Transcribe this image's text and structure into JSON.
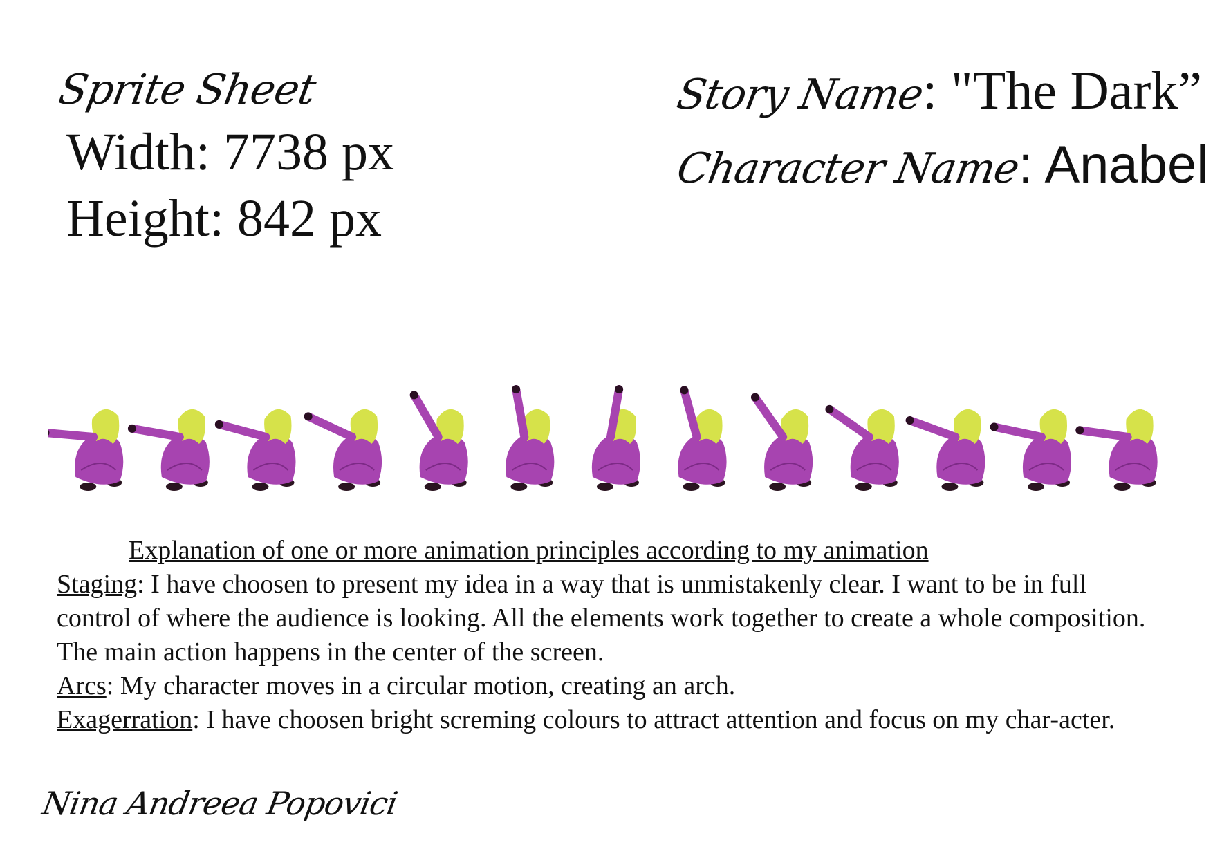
{
  "header": {
    "sprite_sheet_label": "Sprite Sheet",
    "width_text": "Width: 7738 px",
    "height_text": "Height: 842 px",
    "story_label": "Story Name",
    "story_value": ": \"The Dark”",
    "character_label": "Character Name",
    "character_value": ": Anabel"
  },
  "sprite_strip": {
    "frame_count": 13,
    "arm_angles_deg": [
      175,
      170,
      165,
      155,
      120,
      100,
      80,
      105,
      125,
      145,
      160,
      168,
      172
    ],
    "colors": {
      "hair": "#d6e24a",
      "body": "#a744b0",
      "body_shadow": "#7d2a86",
      "hands": "#2a0f22",
      "shoes": "#2a1420"
    }
  },
  "explanation": {
    "heading": "Explanation of one or more animation principles according to my animation ",
    "items": [
      {
        "term": "Staging",
        "text": ": I have choosen to present my idea in a way that is unmistakenly clear. I want to be in full control of where the audience is looking. All the elements work together to create a whole composition. The main action happens in the center of the screen."
      },
      {
        "term": "Arcs",
        "text": ":  My character moves in a circular motion, creating an arch."
      },
      {
        "term": "Exagerration",
        "text": ": I have choosen bright screming colours to attract attention and focus on my char-acter."
      }
    ]
  },
  "signature": "Nina Andreea Popovici"
}
